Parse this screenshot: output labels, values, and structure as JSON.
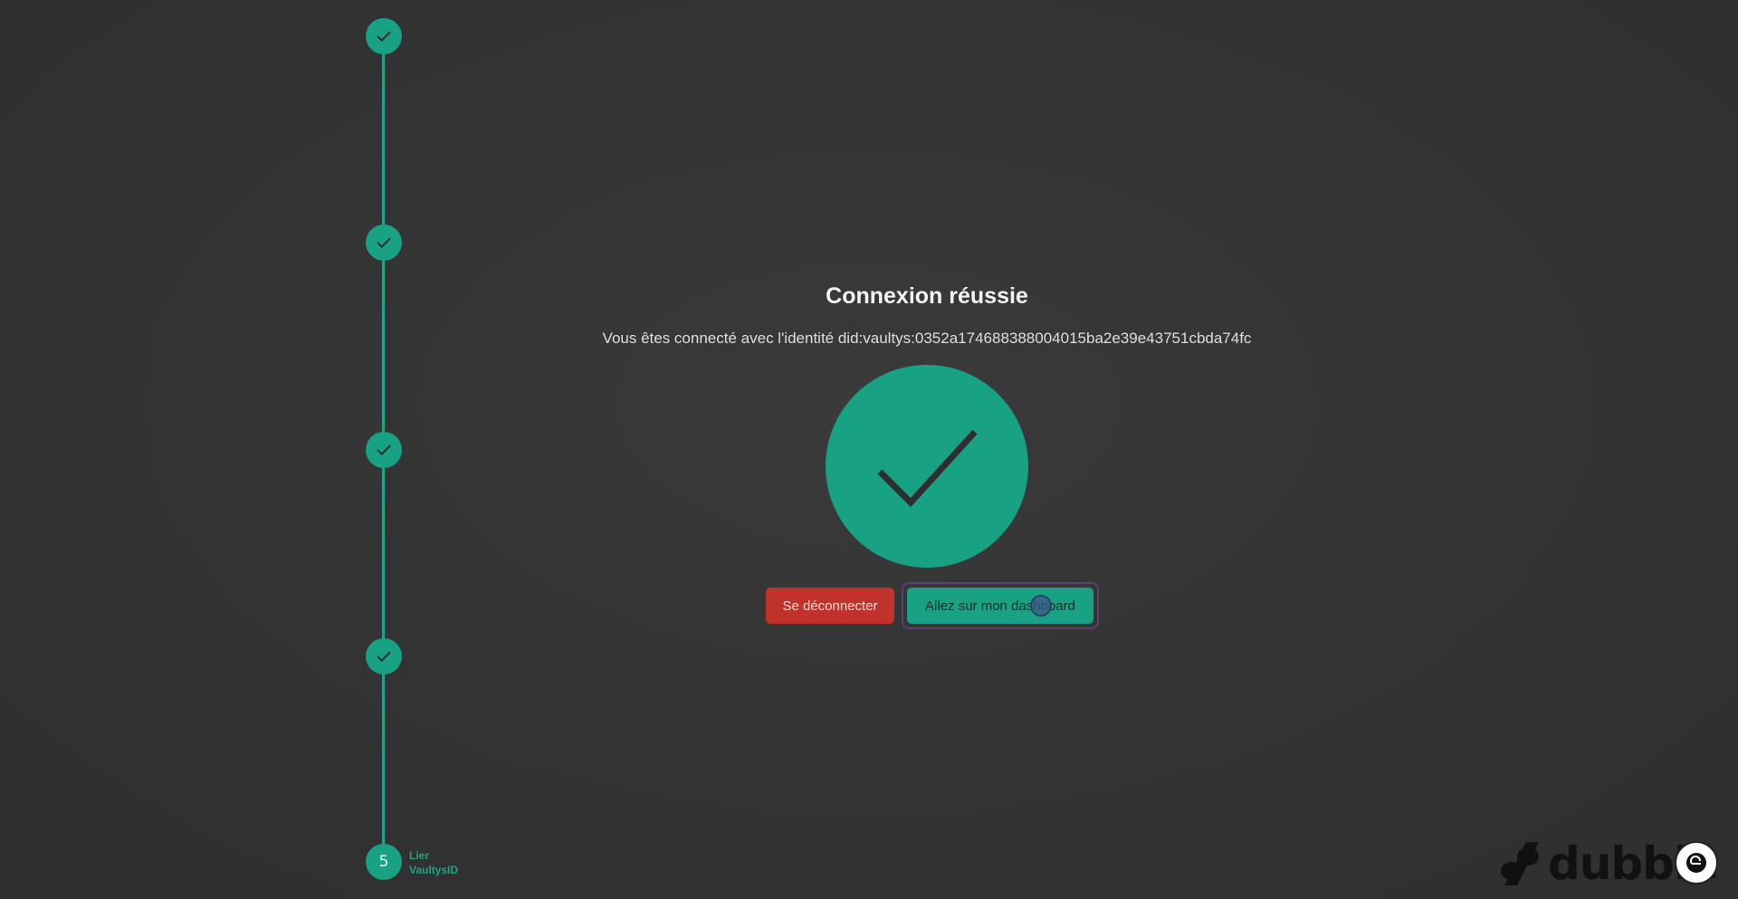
{
  "stepper": {
    "steps": [
      {
        "status": "done",
        "icon": "check-icon"
      },
      {
        "status": "done",
        "icon": "check-icon"
      },
      {
        "status": "done",
        "icon": "check-icon"
      },
      {
        "status": "done",
        "icon": "check-icon"
      },
      {
        "status": "current",
        "number": "5",
        "label_line1": "Lier",
        "label_line2": "VaultysID"
      }
    ]
  },
  "main": {
    "title": "Connexion réussie",
    "subtitle": "Vous êtes connecté avec l'identité did:vaultys:0352a174688388004015ba2e39e43751cbda74fc",
    "logout_label": "Se déconnecter",
    "dashboard_label": "Allez sur mon dashboard"
  },
  "brand": {
    "name": "dubble"
  },
  "colors": {
    "accent": "#18a283",
    "danger": "#c0322a",
    "background": "#333334"
  }
}
